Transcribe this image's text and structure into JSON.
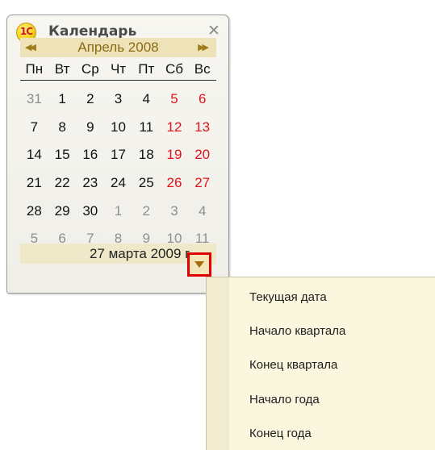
{
  "window": {
    "logo_text": "1С",
    "title": "Календарь",
    "close_glyph": "✕"
  },
  "month_nav": {
    "prev_glyph": "◀◀",
    "label": "Апрель 2008",
    "next_glyph": "▶▶"
  },
  "weekdays": [
    "Пн",
    "Вт",
    "Ср",
    "Чт",
    "Пт",
    "Сб",
    "Вс"
  ],
  "weeks": [
    [
      {
        "d": "31",
        "t": "other"
      },
      {
        "d": "1",
        "t": "cur"
      },
      {
        "d": "2",
        "t": "cur"
      },
      {
        "d": "3",
        "t": "cur"
      },
      {
        "d": "4",
        "t": "cur"
      },
      {
        "d": "5",
        "t": "weekend"
      },
      {
        "d": "6",
        "t": "weekend"
      }
    ],
    [
      {
        "d": "7",
        "t": "cur"
      },
      {
        "d": "8",
        "t": "cur"
      },
      {
        "d": "9",
        "t": "cur"
      },
      {
        "d": "10",
        "t": "cur"
      },
      {
        "d": "11",
        "t": "cur"
      },
      {
        "d": "12",
        "t": "weekend"
      },
      {
        "d": "13",
        "t": "weekend"
      }
    ],
    [
      {
        "d": "14",
        "t": "cur"
      },
      {
        "d": "15",
        "t": "cur"
      },
      {
        "d": "16",
        "t": "cur"
      },
      {
        "d": "17",
        "t": "cur"
      },
      {
        "d": "18",
        "t": "cur"
      },
      {
        "d": "19",
        "t": "weekend"
      },
      {
        "d": "20",
        "t": "weekend"
      }
    ],
    [
      {
        "d": "21",
        "t": "cur"
      },
      {
        "d": "22",
        "t": "cur"
      },
      {
        "d": "23",
        "t": "cur"
      },
      {
        "d": "24",
        "t": "cur"
      },
      {
        "d": "25",
        "t": "cur"
      },
      {
        "d": "26",
        "t": "weekend"
      },
      {
        "d": "27",
        "t": "weekend"
      }
    ],
    [
      {
        "d": "28",
        "t": "cur"
      },
      {
        "d": "29",
        "t": "cur"
      },
      {
        "d": "30",
        "t": "cur"
      },
      {
        "d": "1",
        "t": "other"
      },
      {
        "d": "2",
        "t": "other"
      },
      {
        "d": "3",
        "t": "other"
      },
      {
        "d": "4",
        "t": "other"
      }
    ],
    [
      {
        "d": "5",
        "t": "other"
      },
      {
        "d": "6",
        "t": "other"
      },
      {
        "d": "7",
        "t": "other"
      },
      {
        "d": "8",
        "t": "other"
      },
      {
        "d": "9",
        "t": "other"
      },
      {
        "d": "10",
        "t": "other"
      },
      {
        "d": "11",
        "t": "other"
      }
    ]
  ],
  "selected_date": "27 марта 2009 г.",
  "dropdown_icon": "triangle-down-icon",
  "menu": {
    "items": [
      {
        "label": "Текущая дата"
      },
      {
        "label": "Начало квартала"
      },
      {
        "label": "Конец квартала"
      },
      {
        "label": "Начало года"
      },
      {
        "label": "Конец года"
      }
    ]
  },
  "colors": {
    "weekend": "#e2141a",
    "other_month": "#8f8f8f",
    "highlight_border": "#e00000",
    "month_bar": "#ede2b8",
    "menu_bg": "#fbf6de"
  }
}
